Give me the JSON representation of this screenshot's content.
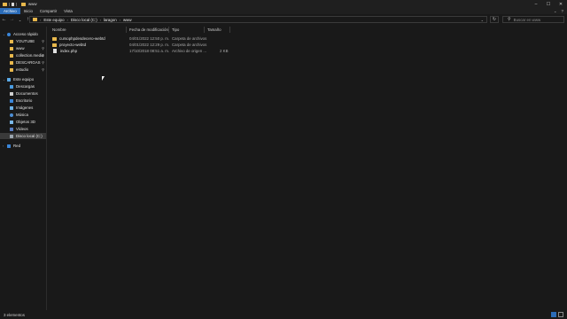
{
  "window": {
    "title": "www",
    "controls": [
      "–",
      "☐",
      "✕"
    ]
  },
  "ribbon": {
    "tabs": [
      "Archivo",
      "Inicio",
      "Compartir",
      "Vista"
    ],
    "active_tab": "Archivo",
    "right_icons": [
      "expand-ribbon-icon",
      "help-icon"
    ]
  },
  "address": {
    "crumbs": [
      "Este equipo",
      "Disco local (C:)",
      "laragon",
      "www"
    ],
    "search_placeholder": "Buscar en www",
    "refresh_icon": "refresh-icon"
  },
  "nav_pane": {
    "quick_access": "Acceso rápido",
    "pinned": [
      "YOUTUBE",
      "www",
      "collection.media",
      "DESCARGAS",
      "estudio"
    ],
    "this_pc": "Este equipo",
    "pc_items": [
      "Descargas",
      "Documentos",
      "Escritorio",
      "Imágenes",
      "Música",
      "Objetos 3D",
      "Vídeos",
      "Disco local (C:)"
    ],
    "network": "Red"
  },
  "columns": [
    "Nombre",
    "Fecha de modificación",
    "Tipo",
    "Tamaño"
  ],
  "files": [
    {
      "name": "cursophpdesdecero-webtd",
      "date": "04/01/2022 12:50 p. m.",
      "type": "Carpeta de archivos",
      "size": "",
      "kind": "folder"
    },
    {
      "name": "proyecto-webtd",
      "date": "04/01/2022 12:29 p. m.",
      "type": "Carpeta de archivos",
      "size": "",
      "kind": "folder"
    },
    {
      "name": "index.php",
      "date": "17/10/2018 08:51 a. m.",
      "type": "Archivo de origen ...",
      "size": "2 KB",
      "kind": "php"
    }
  ],
  "status": {
    "count": "3 elementos"
  },
  "colors": {
    "accent": "#2b6cb8",
    "folder": "#e8b84c",
    "background": "#191919"
  }
}
